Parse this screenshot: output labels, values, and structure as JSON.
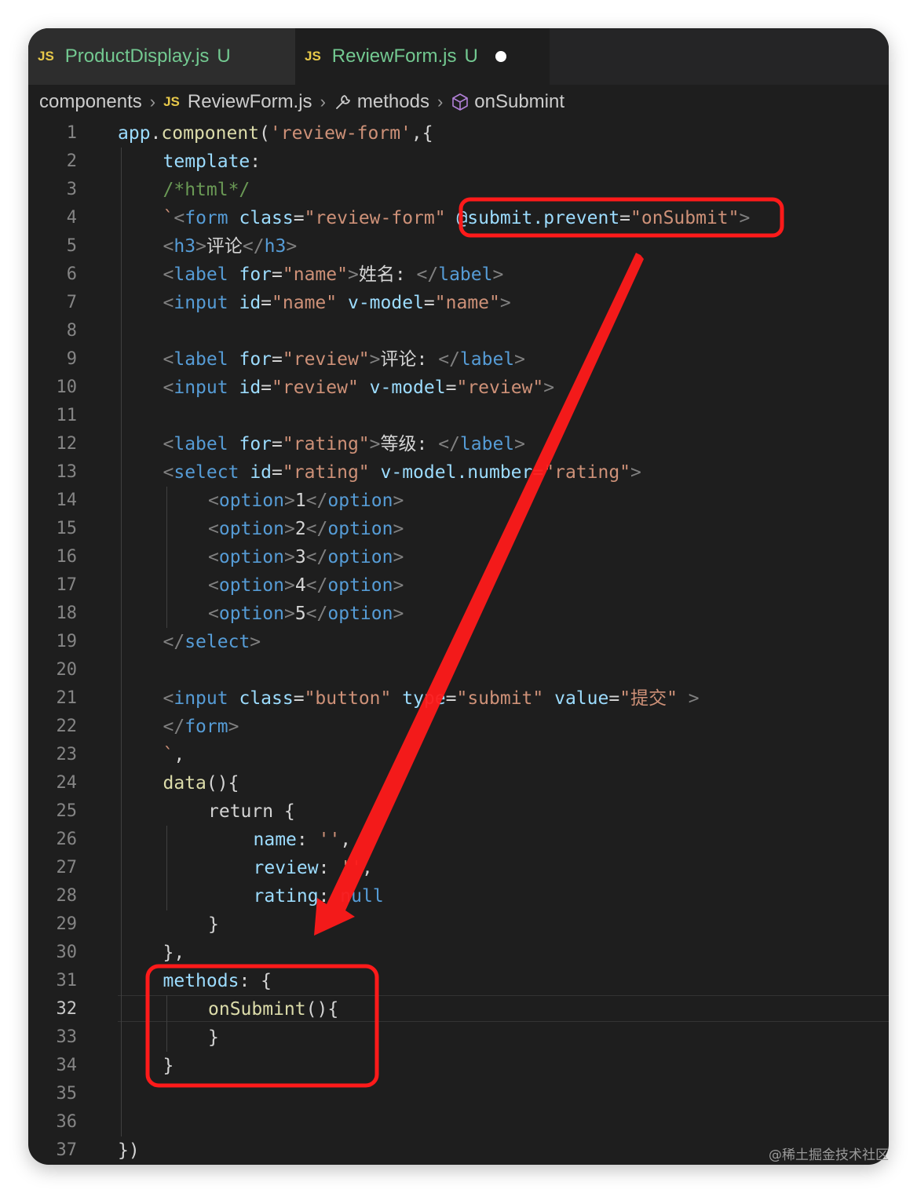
{
  "tabs": [
    {
      "badge": "JS",
      "name": "ProductDisplay.js",
      "status": "U"
    },
    {
      "badge": "JS",
      "name": "ReviewForm.js",
      "status": "U"
    }
  ],
  "breadcrumb": {
    "folder": "components",
    "file_badge": "JS",
    "file": "ReviewForm.js",
    "section": "methods",
    "symbol": "onSubmint"
  },
  "active_line": 32,
  "code_lines": [
    {
      "n": 1,
      "indent": 0,
      "t": [
        [
          "k-blue",
          "app"
        ],
        [
          "k-plain",
          "."
        ],
        [
          "k-fn",
          "component"
        ],
        [
          "k-plain",
          "("
        ],
        [
          "k-str",
          "'review-form'"
        ],
        [
          "k-plain",
          ",{"
        ]
      ]
    },
    {
      "n": 2,
      "indent": 1,
      "t": [
        [
          "k-blue",
          "template"
        ],
        [
          "k-plain",
          ":"
        ]
      ]
    },
    {
      "n": 3,
      "indent": 1,
      "t": [
        [
          "k-com",
          "/*html*/"
        ]
      ]
    },
    {
      "n": 4,
      "indent": 1,
      "t": [
        [
          "k-str",
          "`"
        ],
        [
          "k-br",
          "<"
        ],
        [
          "k-tag",
          "form"
        ],
        [
          "k-plain",
          " "
        ],
        [
          "k-blue",
          "class"
        ],
        [
          "k-plain",
          "="
        ],
        [
          "k-str",
          "\"review-form\""
        ],
        [
          "k-plain",
          " "
        ],
        [
          "k-blue",
          "@submit.prevent"
        ],
        [
          "k-plain",
          "="
        ],
        [
          "k-str",
          "\"onSubmit\""
        ],
        [
          "k-br",
          ">"
        ]
      ]
    },
    {
      "n": 5,
      "indent": 1,
      "t": [
        [
          "k-br",
          "<"
        ],
        [
          "k-tag",
          "h3"
        ],
        [
          "k-br",
          ">"
        ],
        [
          "k-plain",
          "评论"
        ],
        [
          "k-br",
          "</"
        ],
        [
          "k-tag",
          "h3"
        ],
        [
          "k-br",
          ">"
        ]
      ]
    },
    {
      "n": 6,
      "indent": 1,
      "t": [
        [
          "k-br",
          "<"
        ],
        [
          "k-tag",
          "label"
        ],
        [
          "k-plain",
          " "
        ],
        [
          "k-blue",
          "for"
        ],
        [
          "k-plain",
          "="
        ],
        [
          "k-str",
          "\"name\""
        ],
        [
          "k-br",
          ">"
        ],
        [
          "k-plain",
          "姓名: "
        ],
        [
          "k-br",
          "</"
        ],
        [
          "k-tag",
          "label"
        ],
        [
          "k-br",
          ">"
        ]
      ]
    },
    {
      "n": 7,
      "indent": 1,
      "t": [
        [
          "k-br",
          "<"
        ],
        [
          "k-tag",
          "input"
        ],
        [
          "k-plain",
          " "
        ],
        [
          "k-blue",
          "id"
        ],
        [
          "k-plain",
          "="
        ],
        [
          "k-str",
          "\"name\""
        ],
        [
          "k-plain",
          " "
        ],
        [
          "k-blue",
          "v-model"
        ],
        [
          "k-plain",
          "="
        ],
        [
          "k-str",
          "\"name\""
        ],
        [
          "k-br",
          ">"
        ]
      ]
    },
    {
      "n": 8,
      "indent": 1,
      "t": []
    },
    {
      "n": 9,
      "indent": 1,
      "t": [
        [
          "k-br",
          "<"
        ],
        [
          "k-tag",
          "label"
        ],
        [
          "k-plain",
          " "
        ],
        [
          "k-blue",
          "for"
        ],
        [
          "k-plain",
          "="
        ],
        [
          "k-str",
          "\"review\""
        ],
        [
          "k-br",
          ">"
        ],
        [
          "k-plain",
          "评论: "
        ],
        [
          "k-br",
          "</"
        ],
        [
          "k-tag",
          "label"
        ],
        [
          "k-br",
          ">"
        ]
      ]
    },
    {
      "n": 10,
      "indent": 1,
      "t": [
        [
          "k-br",
          "<"
        ],
        [
          "k-tag",
          "input"
        ],
        [
          "k-plain",
          " "
        ],
        [
          "k-blue",
          "id"
        ],
        [
          "k-plain",
          "="
        ],
        [
          "k-str",
          "\"review\""
        ],
        [
          "k-plain",
          " "
        ],
        [
          "k-blue",
          "v-model"
        ],
        [
          "k-plain",
          "="
        ],
        [
          "k-str",
          "\"review\""
        ],
        [
          "k-br",
          ">"
        ]
      ]
    },
    {
      "n": 11,
      "indent": 1,
      "t": []
    },
    {
      "n": 12,
      "indent": 1,
      "t": [
        [
          "k-br",
          "<"
        ],
        [
          "k-tag",
          "label"
        ],
        [
          "k-plain",
          " "
        ],
        [
          "k-blue",
          "for"
        ],
        [
          "k-plain",
          "="
        ],
        [
          "k-str",
          "\"rating\""
        ],
        [
          "k-br",
          ">"
        ],
        [
          "k-plain",
          "等级: "
        ],
        [
          "k-br",
          "</"
        ],
        [
          "k-tag",
          "label"
        ],
        [
          "k-br",
          ">"
        ]
      ]
    },
    {
      "n": 13,
      "indent": 1,
      "t": [
        [
          "k-br",
          "<"
        ],
        [
          "k-tag",
          "select"
        ],
        [
          "k-plain",
          " "
        ],
        [
          "k-blue",
          "id"
        ],
        [
          "k-plain",
          "="
        ],
        [
          "k-str",
          "\"rating\""
        ],
        [
          "k-plain",
          " "
        ],
        [
          "k-blue",
          "v-model.number"
        ],
        [
          "k-plain",
          "="
        ],
        [
          "k-str",
          "\"rating\""
        ],
        [
          "k-br",
          ">"
        ]
      ]
    },
    {
      "n": 14,
      "indent": 2,
      "t": [
        [
          "k-br",
          "<"
        ],
        [
          "k-tag",
          "option"
        ],
        [
          "k-br",
          ">"
        ],
        [
          "k-plain",
          "1"
        ],
        [
          "k-br",
          "</"
        ],
        [
          "k-tag",
          "option"
        ],
        [
          "k-br",
          ">"
        ]
      ]
    },
    {
      "n": 15,
      "indent": 2,
      "t": [
        [
          "k-br",
          "<"
        ],
        [
          "k-tag",
          "option"
        ],
        [
          "k-br",
          ">"
        ],
        [
          "k-plain",
          "2"
        ],
        [
          "k-br",
          "</"
        ],
        [
          "k-tag",
          "option"
        ],
        [
          "k-br",
          ">"
        ]
      ]
    },
    {
      "n": 16,
      "indent": 2,
      "t": [
        [
          "k-br",
          "<"
        ],
        [
          "k-tag",
          "option"
        ],
        [
          "k-br",
          ">"
        ],
        [
          "k-plain",
          "3"
        ],
        [
          "k-br",
          "</"
        ],
        [
          "k-tag",
          "option"
        ],
        [
          "k-br",
          ">"
        ]
      ]
    },
    {
      "n": 17,
      "indent": 2,
      "t": [
        [
          "k-br",
          "<"
        ],
        [
          "k-tag",
          "option"
        ],
        [
          "k-br",
          ">"
        ],
        [
          "k-plain",
          "4"
        ],
        [
          "k-br",
          "</"
        ],
        [
          "k-tag",
          "option"
        ],
        [
          "k-br",
          ">"
        ]
      ]
    },
    {
      "n": 18,
      "indent": 2,
      "t": [
        [
          "k-br",
          "<"
        ],
        [
          "k-tag",
          "option"
        ],
        [
          "k-br",
          ">"
        ],
        [
          "k-plain",
          "5"
        ],
        [
          "k-br",
          "</"
        ],
        [
          "k-tag",
          "option"
        ],
        [
          "k-br",
          ">"
        ]
      ]
    },
    {
      "n": 19,
      "indent": 1,
      "t": [
        [
          "k-br",
          "</"
        ],
        [
          "k-tag",
          "select"
        ],
        [
          "k-br",
          ">"
        ]
      ]
    },
    {
      "n": 20,
      "indent": 1,
      "t": []
    },
    {
      "n": 21,
      "indent": 1,
      "t": [
        [
          "k-br",
          "<"
        ],
        [
          "k-tag",
          "input"
        ],
        [
          "k-plain",
          " "
        ],
        [
          "k-blue",
          "class"
        ],
        [
          "k-plain",
          "="
        ],
        [
          "k-str",
          "\"button\""
        ],
        [
          "k-plain",
          " "
        ],
        [
          "k-blue",
          "type"
        ],
        [
          "k-plain",
          "="
        ],
        [
          "k-str",
          "\"submit\""
        ],
        [
          "k-plain",
          " "
        ],
        [
          "k-blue",
          "value"
        ],
        [
          "k-plain",
          "="
        ],
        [
          "k-str",
          "\"提交\""
        ],
        [
          "k-plain",
          " "
        ],
        [
          "k-br",
          ">"
        ]
      ]
    },
    {
      "n": 22,
      "indent": 1,
      "t": [
        [
          "k-br",
          "</"
        ],
        [
          "k-tag",
          "form"
        ],
        [
          "k-br",
          ">"
        ]
      ]
    },
    {
      "n": 23,
      "indent": 1,
      "t": [
        [
          "k-str",
          "`"
        ],
        [
          "k-plain",
          ","
        ]
      ]
    },
    {
      "n": 24,
      "indent": 1,
      "t": [
        [
          "k-fn",
          "data"
        ],
        [
          "k-plain",
          "(){"
        ]
      ]
    },
    {
      "n": 25,
      "indent": 2,
      "t": [
        [
          "k-plain",
          "return {"
        ]
      ]
    },
    {
      "n": 26,
      "indent": 3,
      "t": [
        [
          "k-blue",
          "name"
        ],
        [
          "k-plain",
          ": "
        ],
        [
          "k-str",
          "''"
        ],
        [
          "k-plain",
          ","
        ]
      ]
    },
    {
      "n": 27,
      "indent": 3,
      "t": [
        [
          "k-blue",
          "review"
        ],
        [
          "k-plain",
          ": "
        ],
        [
          "k-str",
          "''"
        ],
        [
          "k-plain",
          ","
        ]
      ]
    },
    {
      "n": 28,
      "indent": 3,
      "t": [
        [
          "k-blue",
          "rating"
        ],
        [
          "k-plain",
          ": "
        ],
        [
          "k-tag",
          "null"
        ]
      ]
    },
    {
      "n": 29,
      "indent": 2,
      "t": [
        [
          "k-plain",
          "}"
        ]
      ]
    },
    {
      "n": 30,
      "indent": 1,
      "t": [
        [
          "k-plain",
          "},"
        ]
      ]
    },
    {
      "n": 31,
      "indent": 1,
      "t": [
        [
          "k-blue",
          "methods"
        ],
        [
          "k-plain",
          ": {"
        ]
      ]
    },
    {
      "n": 32,
      "indent": 2,
      "t": [
        [
          "k-fn",
          "onSubmint"
        ],
        [
          "k-plain",
          "(){"
        ]
      ]
    },
    {
      "n": 33,
      "indent": 2,
      "t": [
        [
          "k-plain",
          "}"
        ]
      ]
    },
    {
      "n": 34,
      "indent": 1,
      "t": [
        [
          "k-plain",
          "}"
        ]
      ]
    },
    {
      "n": 35,
      "indent": 0,
      "t": []
    },
    {
      "n": 36,
      "indent": 0,
      "t": []
    },
    {
      "n": 37,
      "indent": 0,
      "t": [
        [
          "k-plain",
          "})"
        ]
      ]
    }
  ],
  "annotation": {
    "highlight_color": "#ff1a1a",
    "arrow_color": "#ff1a1a"
  },
  "watermark": "@稀土掘金技术社区"
}
